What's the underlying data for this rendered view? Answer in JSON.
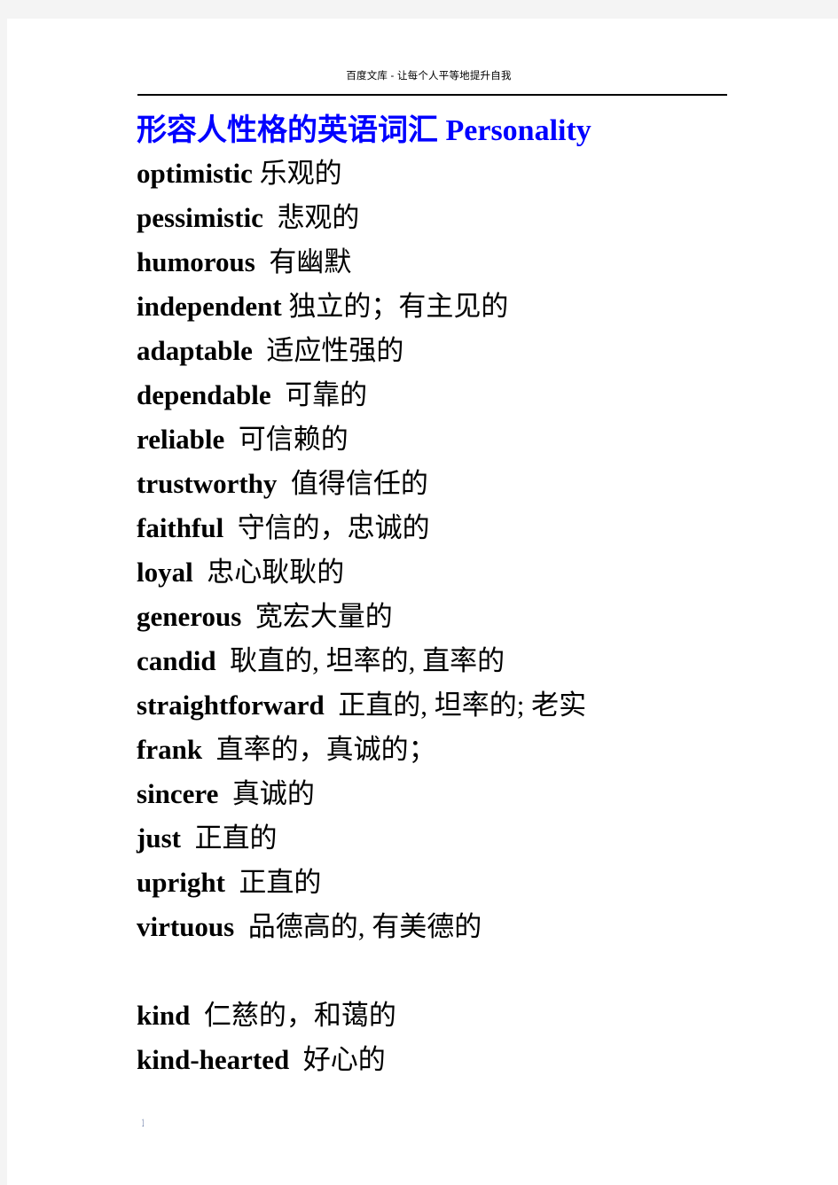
{
  "document": {
    "header_note": "百度文库 - 让每个人平等地提升自我",
    "title_cn": "形容人性格的英语词汇 ",
    "title_en": "Personality",
    "page_number": "1",
    "title_color": "#0000ff",
    "text_color": "#000000",
    "page_background": "#ffffff",
    "canvas_background": "#f4f4f4",
    "entries": [
      {
        "term": "optimistic",
        "gap": " ",
        "gloss": "乐观的"
      },
      {
        "term": "pessimistic",
        "gap": "  ",
        "gloss": "悲观的"
      },
      {
        "term": "humorous",
        "gap": "  ",
        "gloss": "有幽默"
      },
      {
        "term": "independent",
        "gap": " ",
        "gloss": "独立的；有主见的"
      },
      {
        "term": "adaptable",
        "gap": "  ",
        "gloss": "适应性强的"
      },
      {
        "term": "dependable",
        "gap": "  ",
        "gloss": "可靠的"
      },
      {
        "term": "reliable",
        "gap": "  ",
        "gloss": "可信赖的"
      },
      {
        "term": "trustworthy",
        "gap": "  ",
        "gloss": "值得信任的"
      },
      {
        "term": "faithful",
        "gap": "  ",
        "gloss": "守信的，忠诚的"
      },
      {
        "term": "loyal",
        "gap": "  ",
        "gloss": "忠心耿耿的"
      },
      {
        "term": "generous",
        "gap": "  ",
        "gloss": "宽宏大量的"
      },
      {
        "term": "candid",
        "gap": "  ",
        "gloss": "耿直的, 坦率的, 直率的"
      },
      {
        "term": "straightforward",
        "gap": "  ",
        "gloss": "正直的, 坦率的; 老实"
      },
      {
        "term": "frank",
        "gap": "  ",
        "gloss": "直率的，真诚的；"
      },
      {
        "term": "sincere",
        "gap": "  ",
        "gloss": "真诚的"
      },
      {
        "term": "just",
        "gap": "  ",
        "gloss": "正直的"
      },
      {
        "term": "upright",
        "gap": "  ",
        "gloss": "正直的"
      },
      {
        "term": "virtuous",
        "gap": "  ",
        "gloss": "品德高的, 有美德的"
      },
      {
        "term": "",
        "gap": "",
        "gloss": ""
      },
      {
        "term": "kind",
        "gap": "  ",
        "gloss": "仁慈的，和蔼的"
      },
      {
        "term": "kind-hearted",
        "gap": "  ",
        "gloss": "好心的"
      }
    ]
  }
}
